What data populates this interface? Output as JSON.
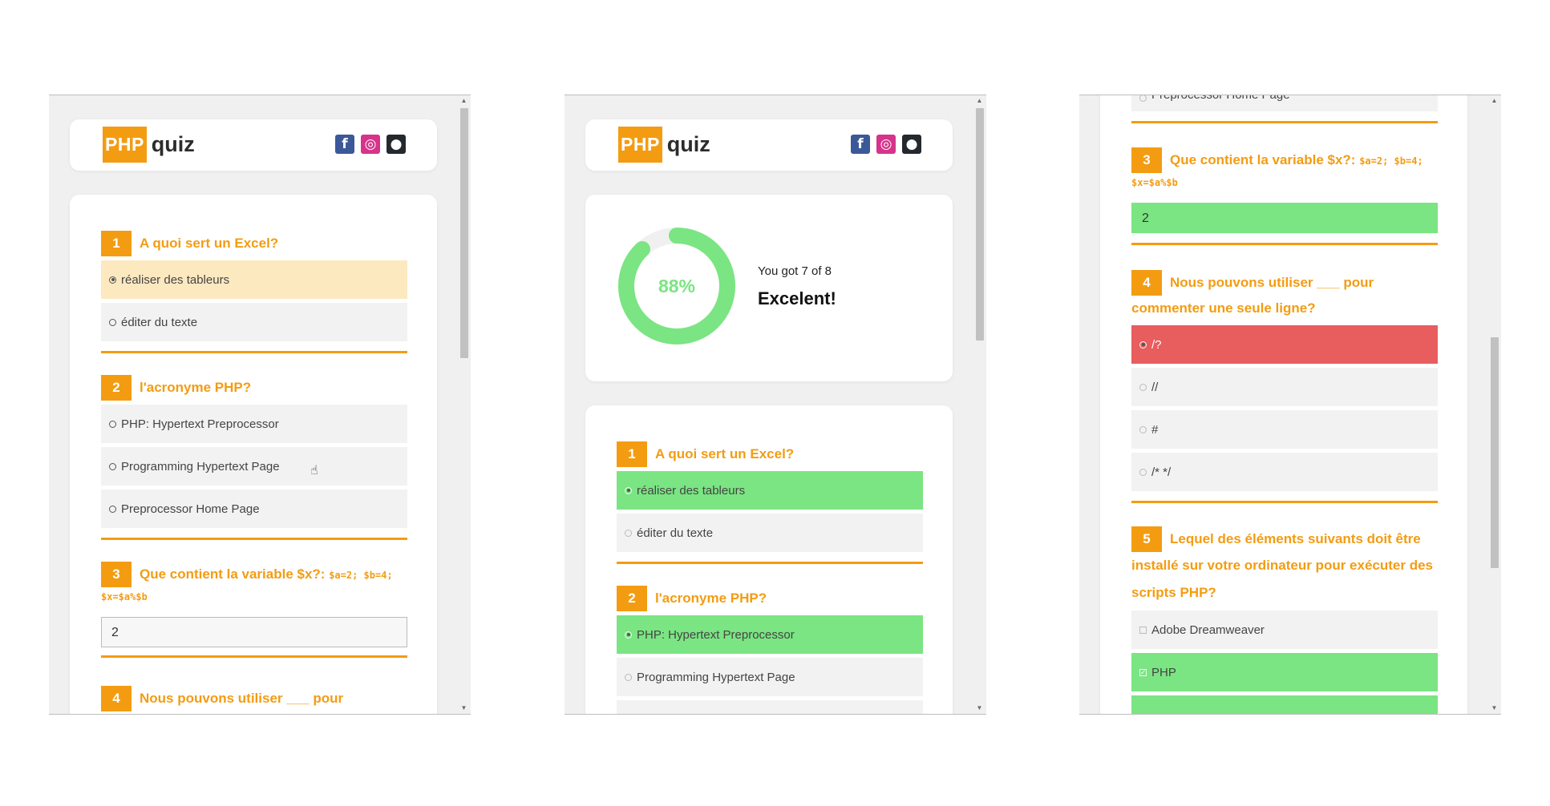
{
  "header": {
    "logo_box": "PHP",
    "logo_text": "quiz",
    "social_icons": [
      "facebook-icon",
      "instagram-icon",
      "github-icon"
    ]
  },
  "questions": {
    "q1": {
      "num": "1",
      "text": "A quoi sert un Excel?",
      "options": [
        "réaliser des tableurs",
        "éditer du texte"
      ]
    },
    "q2": {
      "num": "2",
      "text": "l'acronyme PHP?",
      "options": [
        "PHP: Hypertext Preprocessor",
        "Programming Hypertext Page",
        "Preprocessor Home Page"
      ]
    },
    "q3": {
      "num": "3",
      "text": "Que contient la variable $x?:",
      "code": "$a=2; $b=4;",
      "code2": "$x=$a%$b",
      "answer": "2"
    },
    "q4": {
      "num": "4",
      "text_line1": "Nous pouvons utiliser ___ pour",
      "text_line2": "commenter une seule ligne?",
      "options": [
        "/?",
        "//",
        "#",
        "/* */"
      ]
    },
    "q5": {
      "num": "5",
      "text_line1": "Lequel des éléments suivants doit être",
      "text_line2": "installé sur votre ordinateur pour exécuter des",
      "text_line3": "scripts PHP?",
      "options": [
        "Adobe Dreamweaver",
        "PHP"
      ]
    }
  },
  "result": {
    "percent": 88,
    "percent_label": "88%",
    "line": "You got 7 of 8",
    "message": "Excelent!"
  },
  "colors": {
    "accent": "#f39c12",
    "correct": "#7ae582",
    "wrong": "#e85d5d",
    "selected": "#fde9c0"
  }
}
